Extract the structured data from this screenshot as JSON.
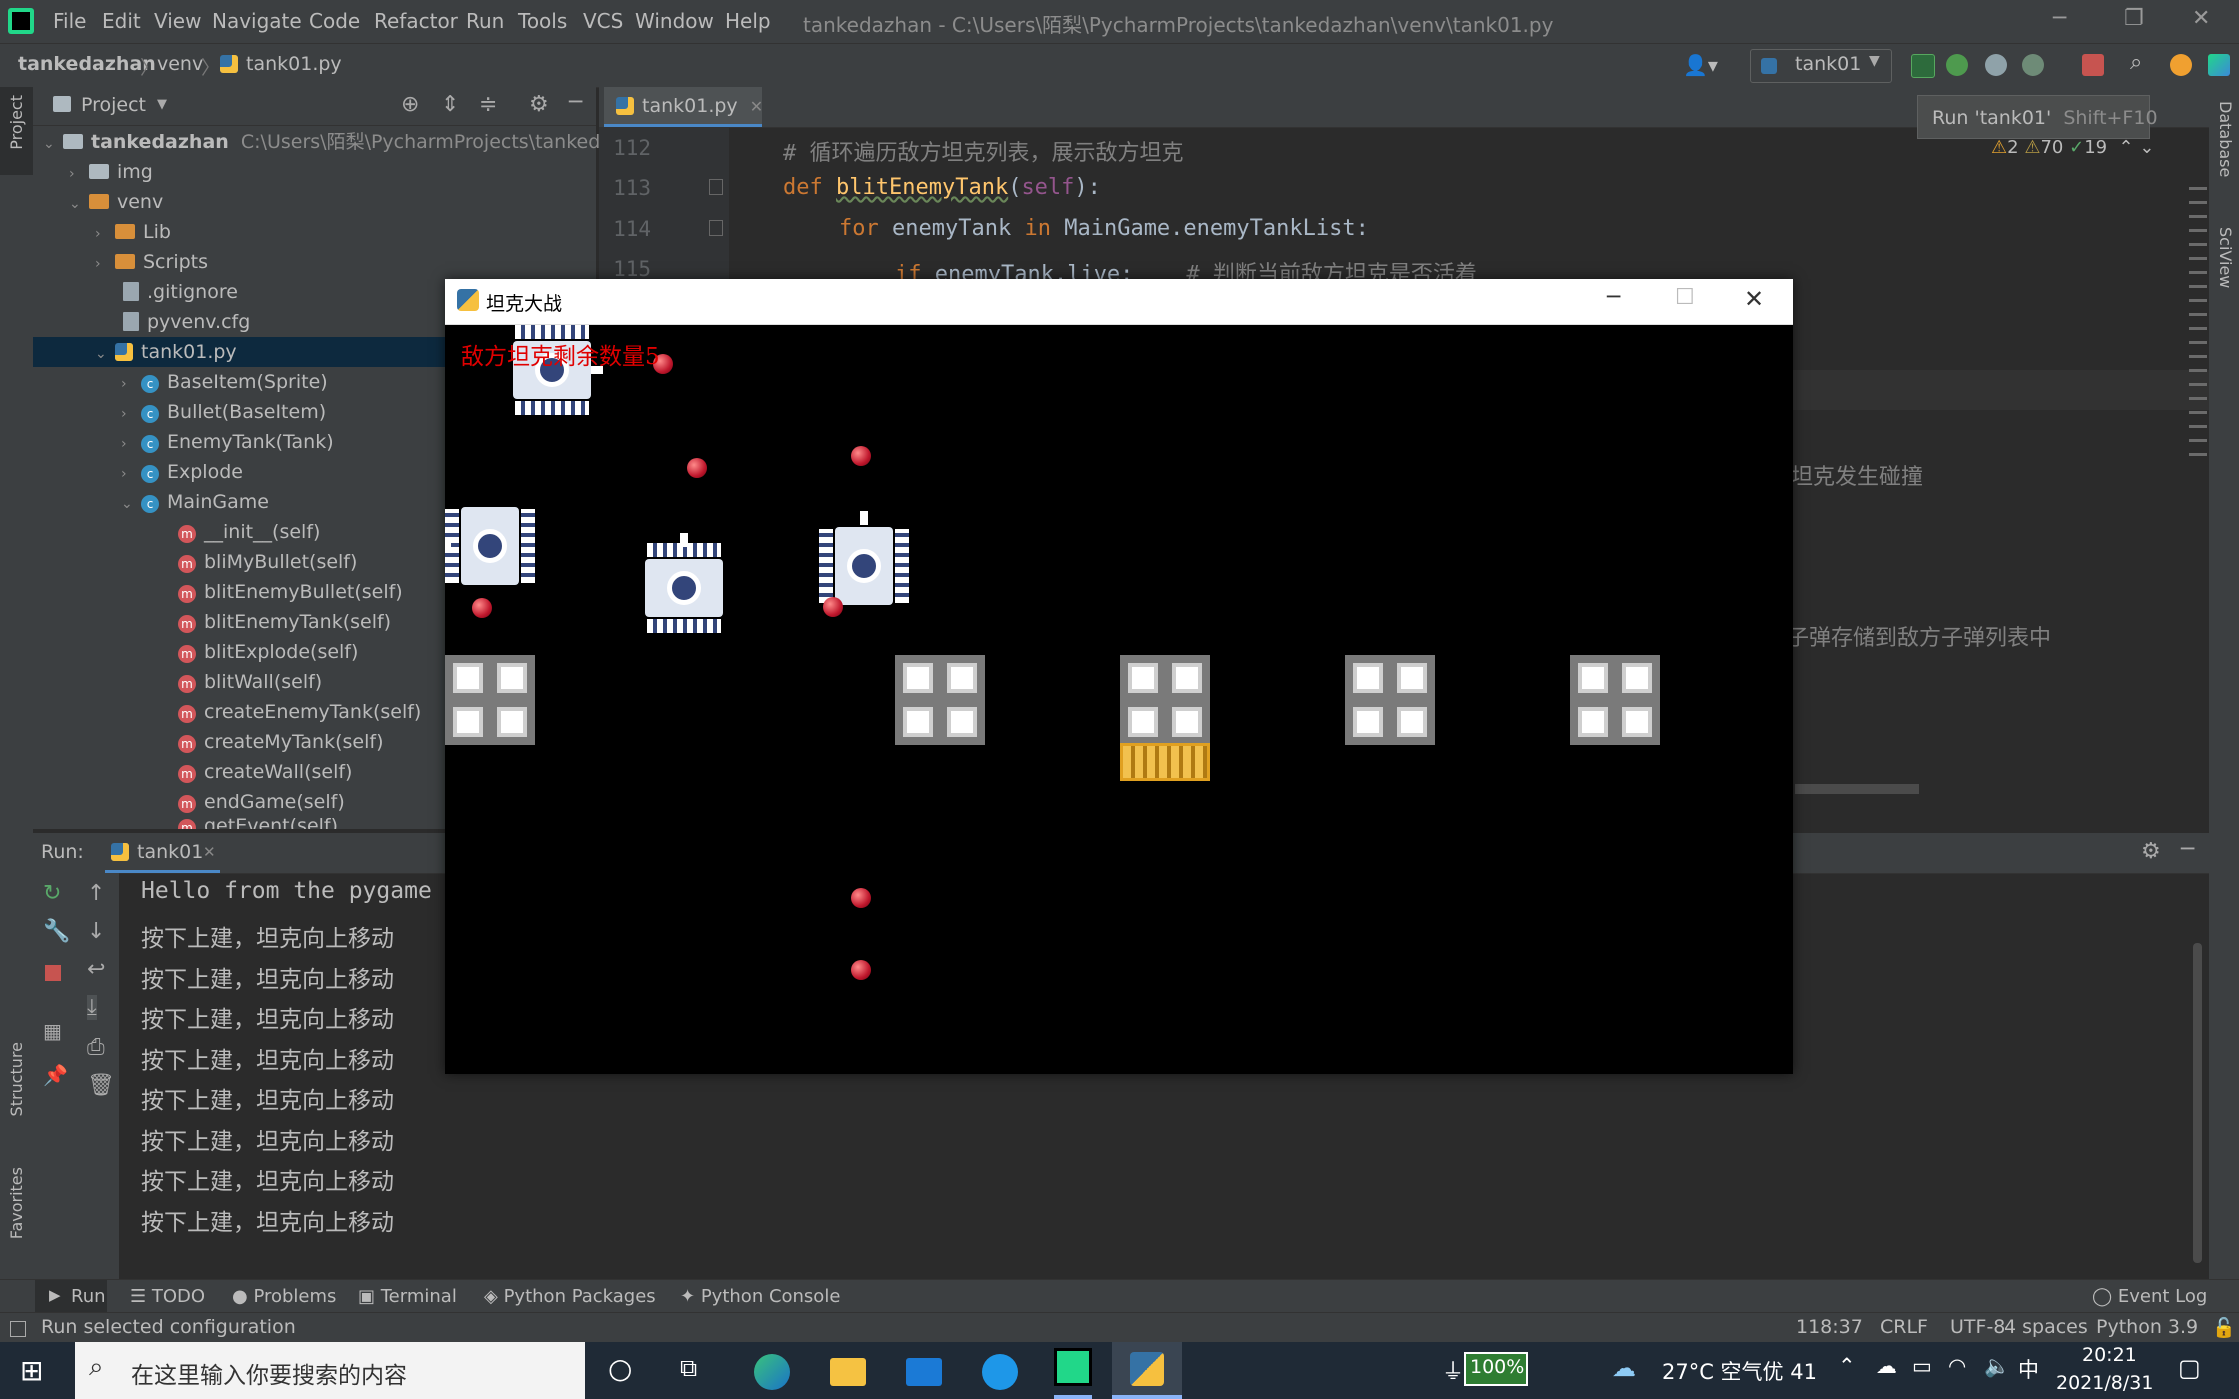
{
  "menubar": {
    "items": [
      "File",
      "Edit",
      "View",
      "Navigate",
      "Code",
      "Refactor",
      "Run",
      "Tools",
      "VCS",
      "Window",
      "Help"
    ],
    "title": "tankedazhan - C:\\Users\\陌梨\\PycharmProjects\\tankedazhan\\venv\\tank01.py"
  },
  "navbar": {
    "crumbs": [
      "tankedazhan",
      "venv",
      "tank01.py"
    ],
    "run_config": "tank01",
    "tooltip_label": "Run 'tank01'",
    "tooltip_shortcut": "Shift+F10"
  },
  "left_tool": {
    "project": "Project",
    "structure": "Structure",
    "favorites": "Favorites"
  },
  "right_tool": {
    "database": "Database",
    "sciview": "SciView"
  },
  "project": {
    "header": "Project",
    "root_name": "tankedazhan",
    "root_path": "C:\\Users\\陌梨\\PycharmProjects\\tankedazhan",
    "items": [
      {
        "label": "img"
      },
      {
        "label": "venv"
      },
      {
        "label": "Lib"
      },
      {
        "label": "Scripts"
      },
      {
        "label": ".gitignore"
      },
      {
        "label": "pyvenv.cfg"
      },
      {
        "label": "tank01.py"
      },
      {
        "label": "BaseItem(Sprite)"
      },
      {
        "label": "Bullet(BaseItem)"
      },
      {
        "label": "EnemyTank(Tank)"
      },
      {
        "label": "Explode"
      },
      {
        "label": "MainGame"
      },
      {
        "label": "__init__(self)"
      },
      {
        "label": "bliMyBullet(self)"
      },
      {
        "label": "blitEnemyBullet(self)"
      },
      {
        "label": "blitEnemyTank(self)"
      },
      {
        "label": "blitExplode(self)"
      },
      {
        "label": "blitWall(self)"
      },
      {
        "label": "createEnemyTank(self)"
      },
      {
        "label": "createMyTank(self)"
      },
      {
        "label": "createWall(self)"
      },
      {
        "label": "endGame(self)"
      },
      {
        "label": "getEvent(self)"
      }
    ]
  },
  "editor": {
    "tab": "tank01.py",
    "inspections": {
      "warnings": "2",
      "weak_warnings": "70",
      "ok": "19"
    },
    "lines": [
      {
        "num": "112",
        "comment": "# 循环遍历敌方坦克列表，展示敌方坦克"
      },
      {
        "num": "113",
        "def_kw": "def",
        "fn": "blitEnemyTank",
        "self": "self",
        "rest": "):"
      },
      {
        "num": "114",
        "for_kw": "for",
        "var": "enemyTank",
        "in_kw": "in",
        "rest": "MainGame.enemyTankList:"
      },
      {
        "num": "115",
        "if_kw": "if",
        "rest": "enemyTank.live:",
        "comment": "# 判断当前敌方坦克是否活着"
      }
    ],
    "partial_1": "坦克发生碰撞",
    "partial_2": "子弹存储到敌方子弹列表中"
  },
  "run": {
    "label": "Run:",
    "tab": "tank01",
    "output": [
      "Hello from the pygame",
      "按下上建，坦克向上移动",
      "按下上建，坦克向上移动",
      "按下上建，坦克向上移动",
      "按下上建，坦克向上移动",
      "按下上建，坦克向上移动",
      "按下上建，坦克向上移动",
      "按下上建，坦克向上移动",
      "按下上建，坦克向上移动"
    ]
  },
  "bottom_tools": [
    "Run",
    "TODO",
    "Problems",
    "Terminal",
    "Python Packages",
    "Python Console"
  ],
  "event_log": "Event Log",
  "status": {
    "message": "Run selected configuration",
    "position": "118:37",
    "line_sep": "CRLF",
    "encoding": "UTF-8",
    "indent": "4 spaces",
    "interpreter": "Python 3.9"
  },
  "pygame": {
    "title": "坦克大战",
    "hud": "敌方坦克剩余数量5"
  },
  "taskbar": {
    "search_placeholder": "在这里输入你要搜索的内容",
    "battery": "100%",
    "weather": "27°C 空气优 41",
    "ime": "中",
    "time": "20:21",
    "date": "2021/8/31"
  }
}
